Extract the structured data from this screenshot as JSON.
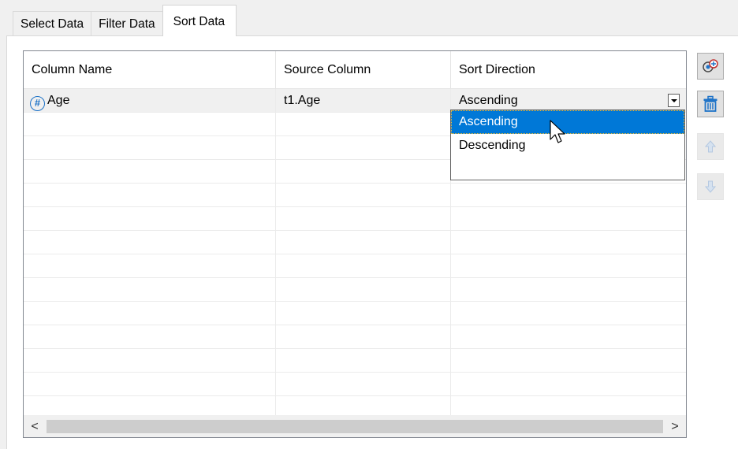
{
  "tabs": [
    {
      "label": "Select Data",
      "active": false
    },
    {
      "label": "Filter Data",
      "active": false
    },
    {
      "label": "Sort Data",
      "active": true
    }
  ],
  "grid": {
    "columns": [
      "Column Name",
      "Source Column",
      "Sort Direction"
    ],
    "rows": [
      {
        "icon": "numeric-column-icon",
        "column_name": "Age",
        "source_column": "t1.Age",
        "sort_direction": "Ascending"
      }
    ],
    "empty_row_count": 13
  },
  "dropdown": {
    "options": [
      "Ascending",
      "Descending"
    ],
    "selected": "Ascending"
  },
  "scrollbar": {
    "left_arrow": "<",
    "right_arrow": ">"
  },
  "side_buttons": [
    {
      "name": "add-sort-column-icon",
      "enabled": true
    },
    {
      "name": "delete-icon",
      "enabled": true
    },
    {
      "name": "move-up-icon",
      "enabled": false
    },
    {
      "name": "move-down-icon",
      "enabled": false
    }
  ],
  "colors": {
    "accent": "#0078d7",
    "icon_blue": "#1e73c8",
    "disabled_arrow": "#b4c8e1"
  }
}
